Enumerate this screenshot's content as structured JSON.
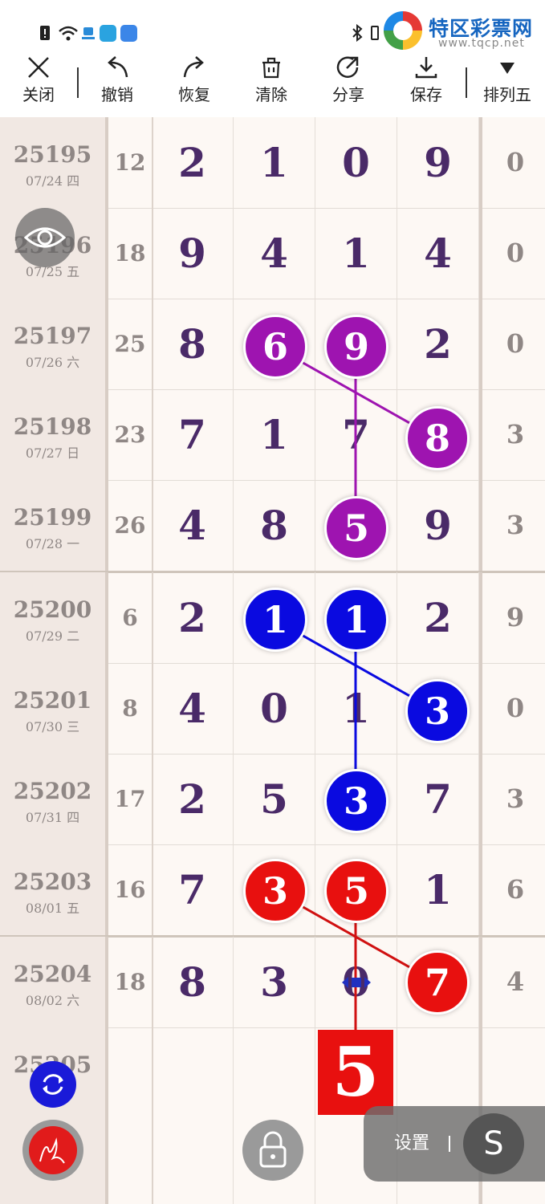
{
  "brand": {
    "name": "特区彩票网",
    "url": "www.tqcp.net"
  },
  "toolbar": {
    "close": "关闭",
    "undo": "撤销",
    "redo": "恢复",
    "clear": "清除",
    "share": "分享",
    "save": "保存",
    "lottery": "排列五"
  },
  "rows": [
    {
      "issue": "25195",
      "date": "07/24 四",
      "sum": "12",
      "d1": "2",
      "d2": "1",
      "d3": "0",
      "d4": "9",
      "span": "0"
    },
    {
      "issue": "25196",
      "date": "07/25 五",
      "sum": "18",
      "d1": "9",
      "d2": "4",
      "d3": "1",
      "d4": "4",
      "span": "0"
    },
    {
      "issue": "25197",
      "date": "07/26 六",
      "sum": "25",
      "d1": "8",
      "d2": "6",
      "d3": "9",
      "d4": "2",
      "span": "0"
    },
    {
      "issue": "25198",
      "date": "07/27 日",
      "sum": "23",
      "d1": "7",
      "d2": "1",
      "d3": "7",
      "d4": "8",
      "span": "3"
    },
    {
      "issue": "25199",
      "date": "07/28 一",
      "sum": "26",
      "d1": "4",
      "d2": "8",
      "d3": "5",
      "d4": "9",
      "span": "3"
    },
    {
      "issue": "25200",
      "date": "07/29 二",
      "sum": "6",
      "d1": "2",
      "d2": "1",
      "d3": "1",
      "d4": "2",
      "span": "9"
    },
    {
      "issue": "25201",
      "date": "07/30 三",
      "sum": "8",
      "d1": "4",
      "d2": "0",
      "d3": "1",
      "d4": "3",
      "span": "0"
    },
    {
      "issue": "25202",
      "date": "07/31 四",
      "sum": "17",
      "d1": "2",
      "d2": "5",
      "d3": "3",
      "d4": "7",
      "span": "3"
    },
    {
      "issue": "25203",
      "date": "08/01 五",
      "sum": "16",
      "d1": "7",
      "d2": "3",
      "d3": "5",
      "d4": "1",
      "span": "6"
    },
    {
      "issue": "25204",
      "date": "08/02 六",
      "sum": "18",
      "d1": "8",
      "d2": "3",
      "d3": "0",
      "d4": "7",
      "span": "4"
    },
    {
      "issue": "25205",
      "date": "",
      "sum": "",
      "d1": "",
      "d2": "",
      "d3": "",
      "d4": "",
      "span": ""
    }
  ],
  "balls": {
    "purple": {
      "color": "#9e14b0",
      "a": "6",
      "b": "9",
      "c": "8",
      "d": "5"
    },
    "blue": {
      "color": "#0a0ae0",
      "a": "1",
      "b": "1",
      "c": "3",
      "d": "3"
    },
    "red": {
      "color": "#e8100f",
      "a": "3",
      "b": "5",
      "c": "7"
    }
  },
  "result": "5",
  "settings": {
    "label": "设置",
    "s": "S"
  },
  "colors": {
    "digit": "#4a2a68",
    "gray_text": "#8f8785",
    "issue_bg": "#f1e8e3"
  },
  "icons": [
    "close-icon",
    "undo-icon",
    "redo-icon",
    "clear-icon",
    "share-icon",
    "save-icon",
    "dropdown-icon",
    "eye-icon",
    "refresh-icon",
    "pen-icon",
    "lock-icon"
  ]
}
